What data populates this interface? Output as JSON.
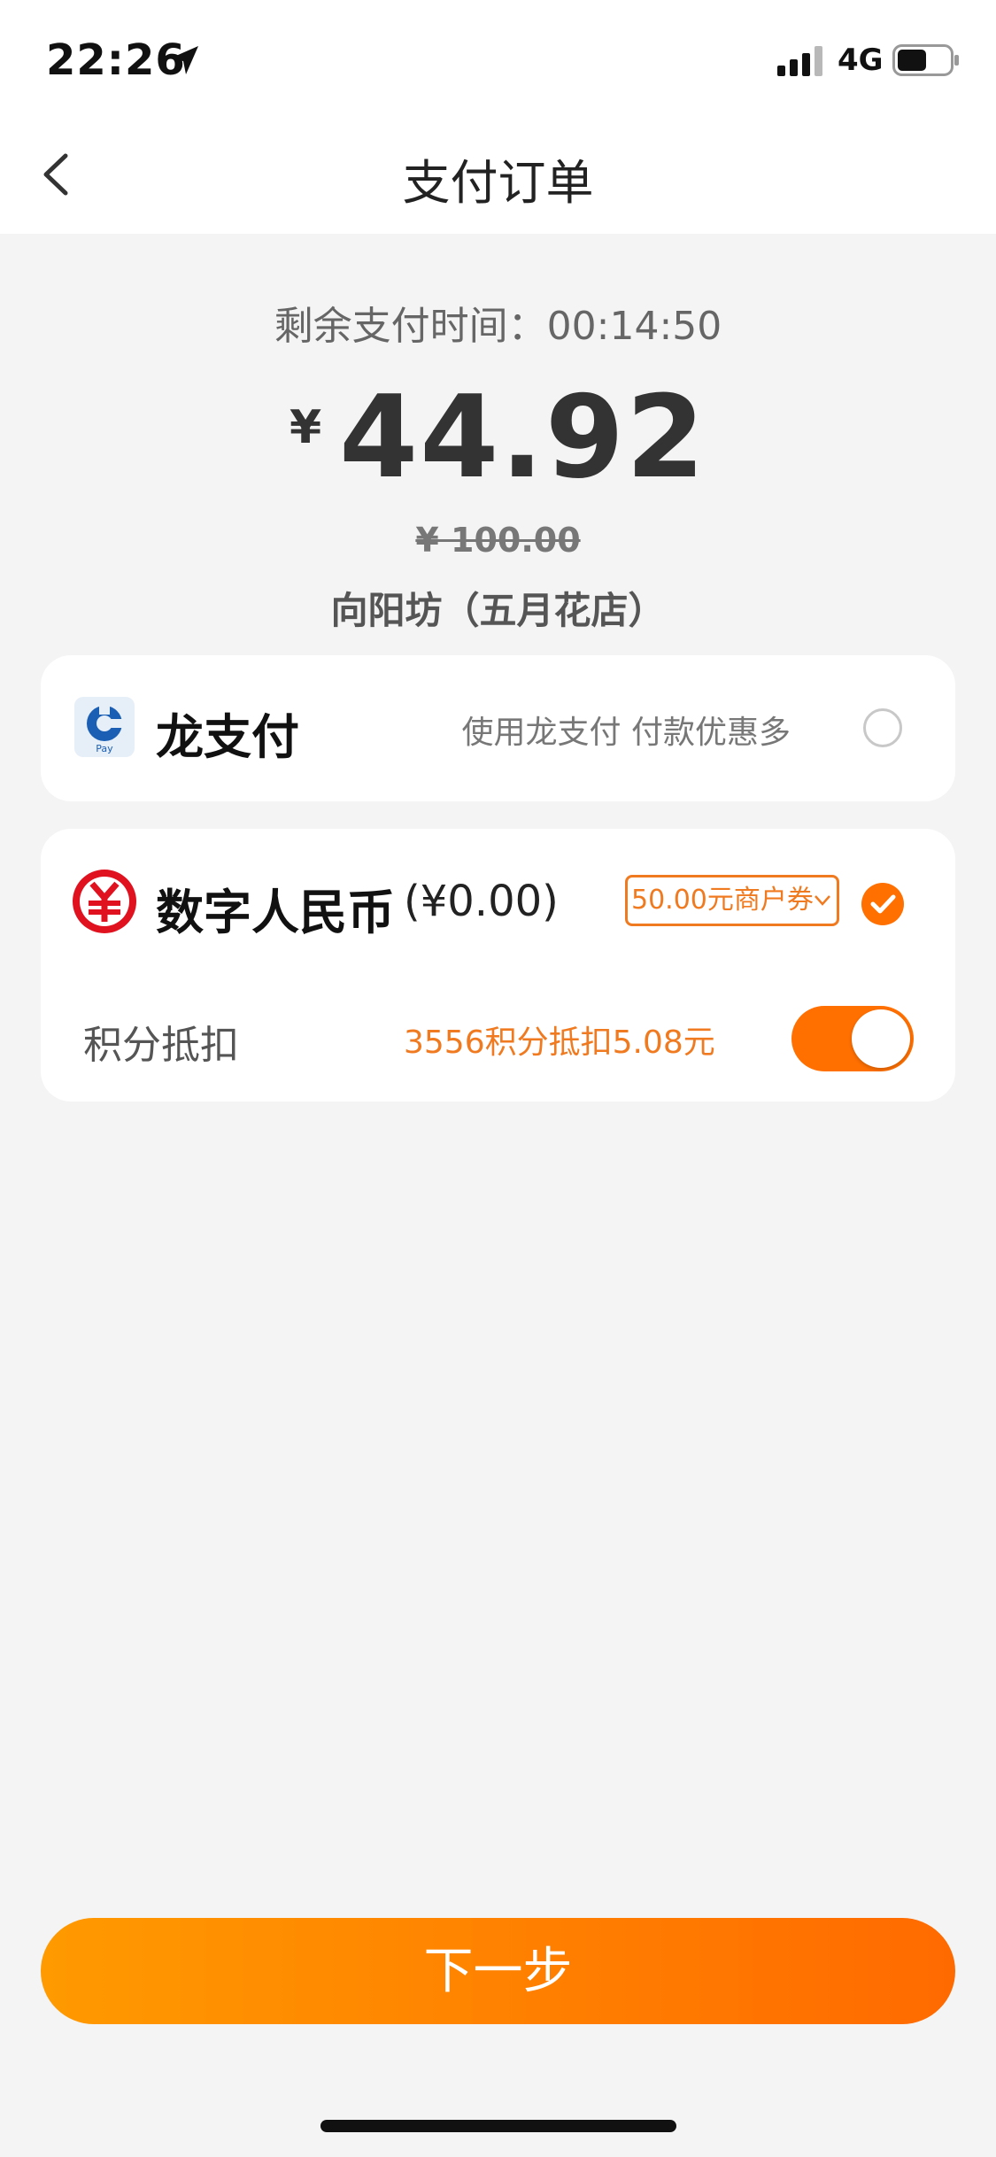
{
  "status_bar": {
    "time": "22:26",
    "network": "4G",
    "icons": [
      "location-arrow-icon",
      "signal-bars-icon",
      "battery-icon"
    ]
  },
  "nav": {
    "title": "支付订单",
    "back_icon": "chevron-left-icon"
  },
  "summary": {
    "countdown": "剩余支付时间：00:14:50",
    "currency_symbol": "¥",
    "amount": "44.92",
    "original_price": "¥ 100.00",
    "merchant": "向阳坊（五月花店）"
  },
  "payment_methods": [
    {
      "name": "龙支付",
      "hint": "使用龙支付 付款优惠多",
      "selected": false,
      "icon": "long-pay-logo-icon"
    },
    {
      "name": "数字人民币",
      "balance": "(¥0.00)",
      "coupon": "50.00元商户券",
      "selected": true,
      "icon": "digital-rmb-logo-icon"
    }
  ],
  "points": {
    "label": "积分抵扣",
    "value": "3556积分抵扣5.08元",
    "enabled": true
  },
  "footer": {
    "next_label": "下一步"
  },
  "colors": {
    "accent": "#ff7000",
    "accent_text": "#f07a20",
    "background": "#f4f4f4"
  }
}
